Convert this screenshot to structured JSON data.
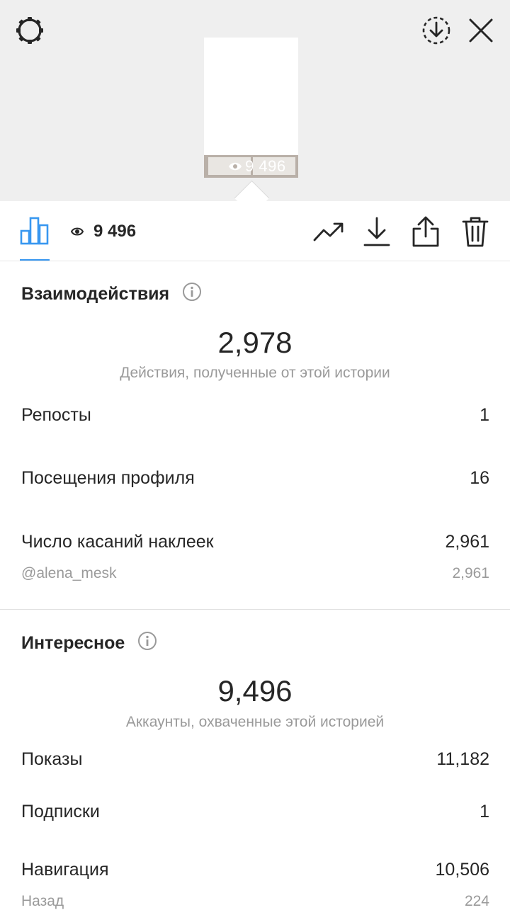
{
  "header": {
    "settings_icon": "gear-icon",
    "save_icon": "download-circle-icon",
    "close_icon": "close-icon",
    "thumbnail_views": "9 496"
  },
  "toolbar": {
    "insights_tab_icon": "bar-chart-icon",
    "views_icon": "eye-icon",
    "views": "9 496",
    "actions": [
      {
        "icon": "trending-up-icon"
      },
      {
        "icon": "download-icon"
      },
      {
        "icon": "share-icon"
      },
      {
        "icon": "trash-icon"
      }
    ]
  },
  "interactions": {
    "title": "Взаимодействия",
    "total": "2,978",
    "caption": "Действия, полученные от этой истории",
    "rows": [
      {
        "label": "Репосты",
        "value": "1"
      },
      {
        "label": "Посещения профиля",
        "value": "16"
      },
      {
        "label": "Число касаний наклеек",
        "value": "2,961"
      }
    ],
    "sub_row": {
      "label": "@alena_mesk",
      "value": "2,961"
    }
  },
  "discovery": {
    "title": "Интересное",
    "total": "9,496",
    "caption": "Аккаунты, охваченные этой историей",
    "rows": [
      {
        "label": "Показы",
        "value": "11,182"
      },
      {
        "label": "Подписки",
        "value": "1"
      },
      {
        "label": "Навигация",
        "value": "10,506"
      }
    ],
    "sub_row": {
      "label": "Назад",
      "value": "224"
    }
  },
  "colors": {
    "accent": "#3897f0",
    "text": "#262626",
    "secondary_text": "#9a9a9a",
    "top_background": "#efefef"
  }
}
